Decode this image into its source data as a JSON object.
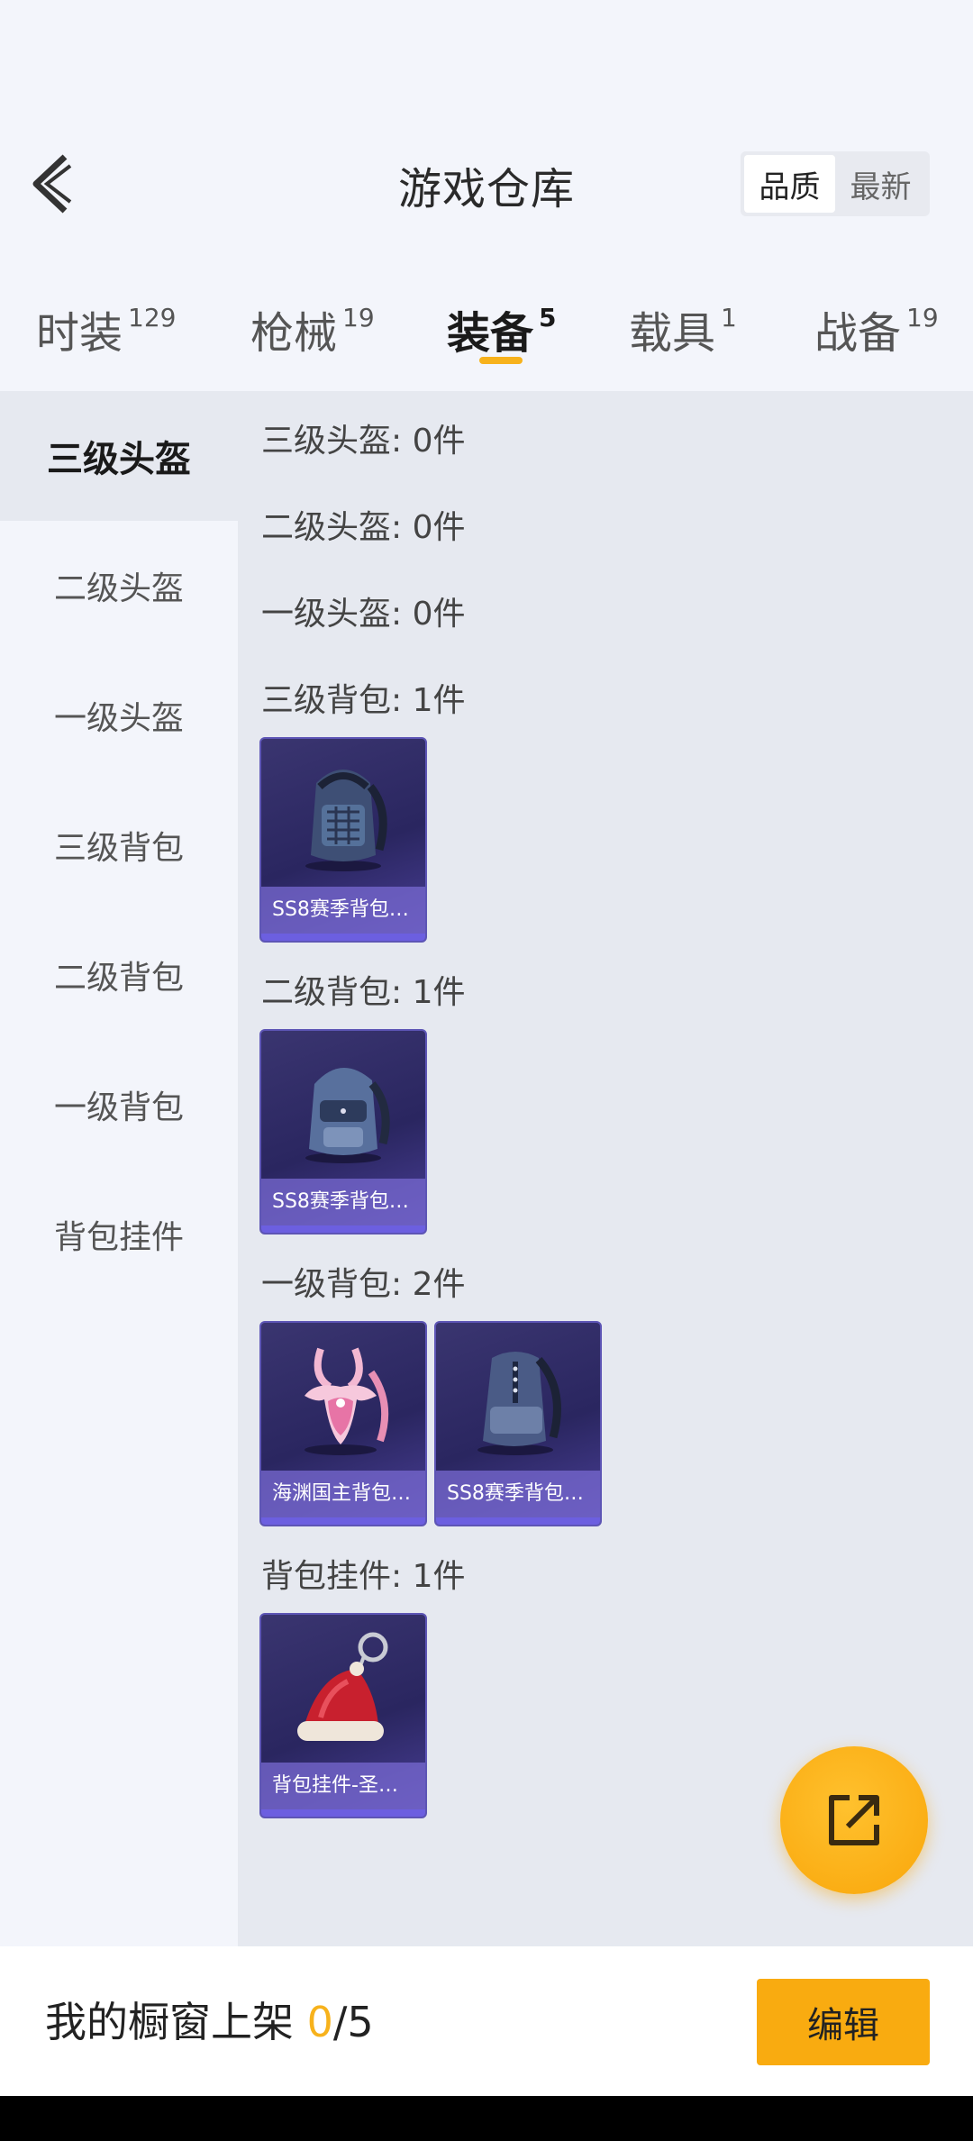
{
  "header": {
    "title": "游戏仓库",
    "sort_options": [
      {
        "label": "品质",
        "active": true
      },
      {
        "label": "最新",
        "active": false
      }
    ]
  },
  "tabs": [
    {
      "label": "时装",
      "count": "129",
      "active": false
    },
    {
      "label": "枪械",
      "count": "19",
      "active": false
    },
    {
      "label": "装备",
      "count": "5",
      "active": true
    },
    {
      "label": "载具",
      "count": "1",
      "active": false
    },
    {
      "label": "战备",
      "count": "19",
      "active": false
    }
  ],
  "sidebar": {
    "items": [
      {
        "label": "三级头盔",
        "active": true
      },
      {
        "label": "二级头盔",
        "active": false
      },
      {
        "label": "一级头盔",
        "active": false
      },
      {
        "label": "三级背包",
        "active": false
      },
      {
        "label": "二级背包",
        "active": false
      },
      {
        "label": "一级背包",
        "active": false
      },
      {
        "label": "背包挂件",
        "active": false
      }
    ]
  },
  "sections": [
    {
      "label": "三级头盔: 0件",
      "items": []
    },
    {
      "label": "二级头盔: 0件",
      "items": []
    },
    {
      "label": "一级头盔: 0件",
      "items": []
    },
    {
      "label": "三级背包: 1件",
      "items": [
        {
          "name": "SS8赛季背包…",
          "icon": "backpack-icon"
        }
      ]
    },
    {
      "label": "二级背包: 1件",
      "items": [
        {
          "name": "SS8赛季背包…",
          "icon": "backpack-icon"
        }
      ]
    },
    {
      "label": "一级背包: 2件",
      "items": [
        {
          "name": "海渊国主背包…",
          "icon": "pink-backpack-icon"
        },
        {
          "name": "SS8赛季背包…",
          "icon": "backpack-icon"
        }
      ]
    },
    {
      "label": "背包挂件: 1件",
      "items": [
        {
          "name": "背包挂件-圣…",
          "icon": "santa-hat-charm-icon"
        }
      ]
    }
  ],
  "bottom": {
    "showcase_label": "我的橱窗上架",
    "showcase_count": "0",
    "showcase_total": "/5",
    "edit_label": "编辑"
  },
  "colors": {
    "accent": "#f7b21c",
    "card_bg": "#2a2660",
    "content_bg": "#e6e9f0"
  }
}
